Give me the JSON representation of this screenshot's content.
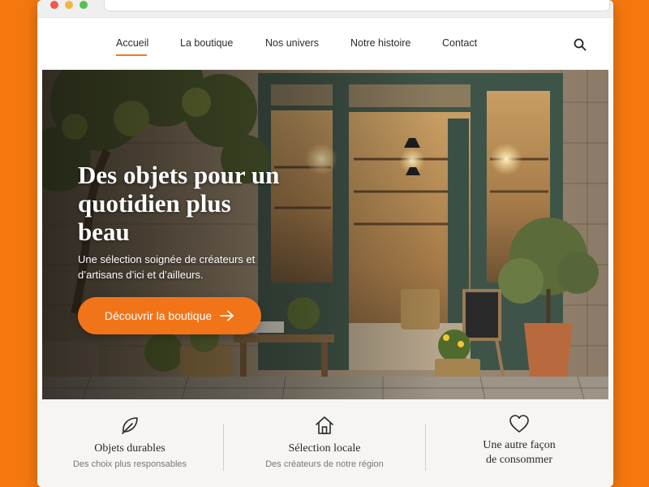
{
  "nav": {
    "items": [
      {
        "label": "Accueil",
        "active": true
      },
      {
        "label": "La boutique"
      },
      {
        "label": "Nos univers"
      },
      {
        "label": "Notre histoire"
      },
      {
        "label": "Contact"
      }
    ],
    "search_icon": "search-icon"
  },
  "hero": {
    "title": "Des objets pour un quotidien plus beau",
    "subtitle": "Une sélection soignée de créateurs et d’artisans d’ici et d’ailleurs.",
    "cta_label": "Découvrir la boutique",
    "cta_icon": "arrow-right-icon"
  },
  "features": [
    {
      "icon": "leaf-icon",
      "title": "Objets durables",
      "subtitle": "Des choix plus responsables"
    },
    {
      "icon": "house-icon",
      "title": "Sélection locale",
      "subtitle": "Des créateurs de notre région"
    },
    {
      "icon": "heart-icon",
      "title_line1": "Une autre façon",
      "title_line2": "de consommer"
    }
  ],
  "colors": {
    "accent": "#f27418",
    "background": "#f5780f",
    "text": "#2b2b2b"
  }
}
